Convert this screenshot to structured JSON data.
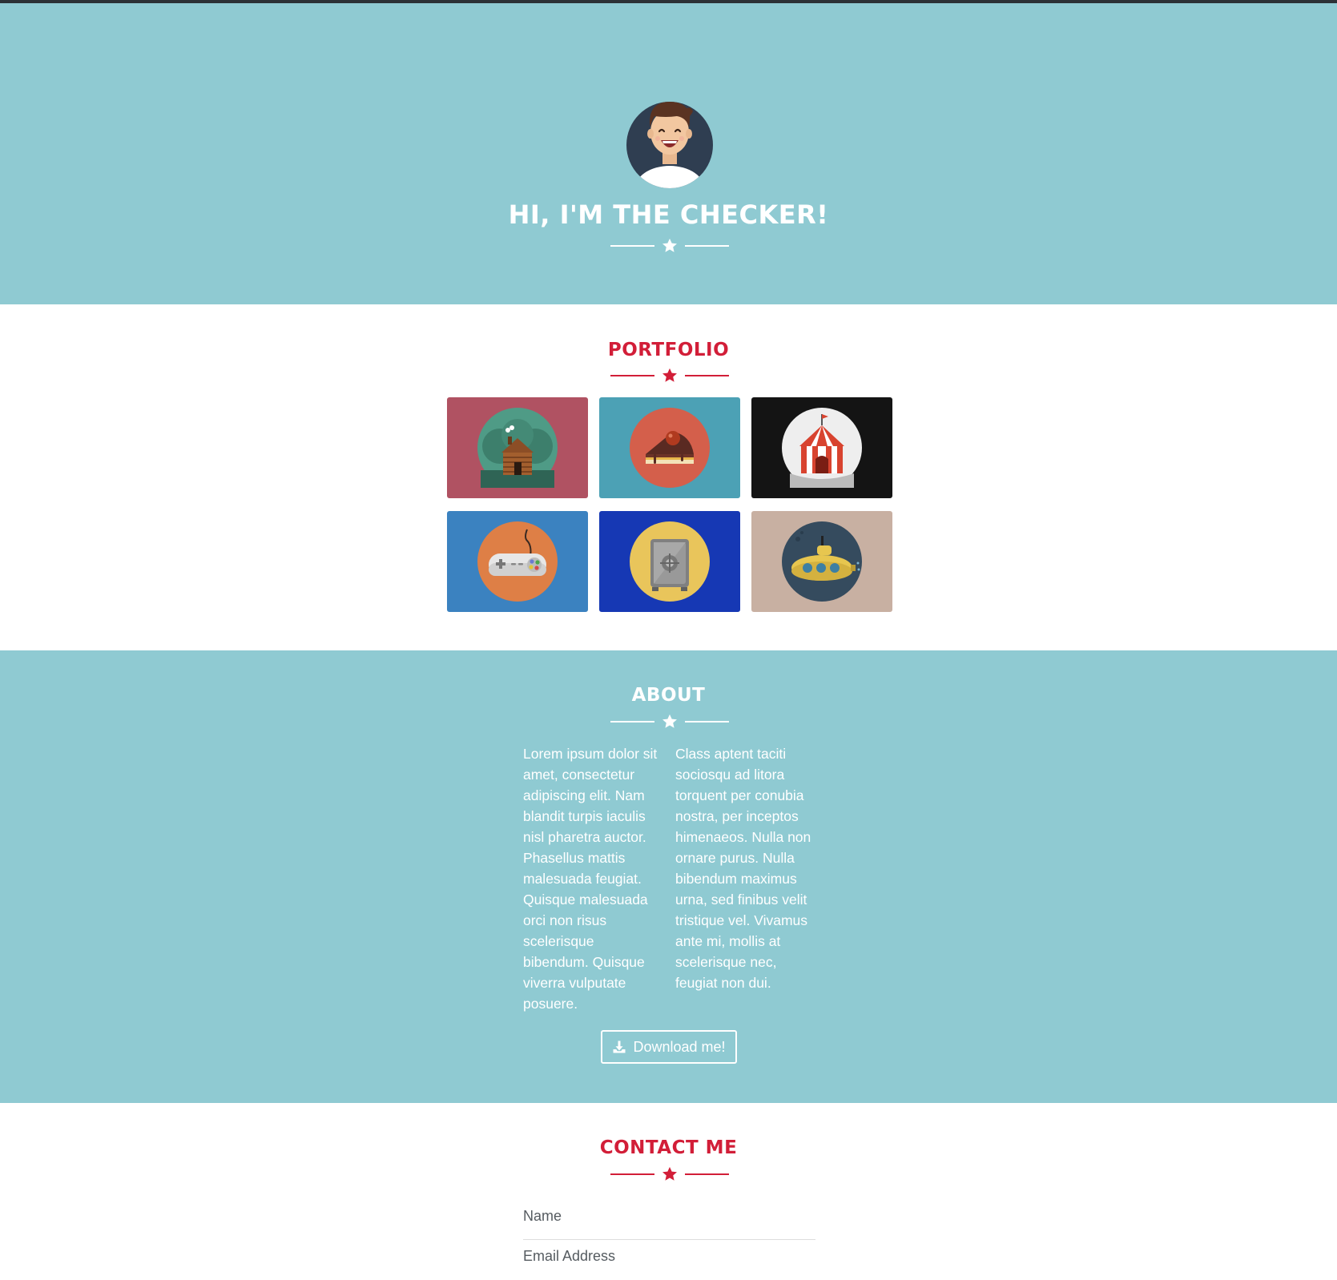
{
  "hero": {
    "title": "HI, I'M THE CHECKER!"
  },
  "portfolio": {
    "title": "PORTFOLIO",
    "items": [
      {
        "icon": "cabin-icon",
        "bg": "#b05262"
      },
      {
        "icon": "cake-icon",
        "bg": "#4ca1b5"
      },
      {
        "icon": "circus-tent-icon",
        "bg": "#141414"
      },
      {
        "icon": "game-controller-icon",
        "bg": "#3b82c0"
      },
      {
        "icon": "safe-icon",
        "bg": "#1638b4"
      },
      {
        "icon": "submarine-icon",
        "bg": "#c8b0a2"
      }
    ]
  },
  "about": {
    "title": "ABOUT",
    "col1": "Lorem ipsum dolor sit amet, consectetur adipiscing elit. Nam blandit turpis iaculis nisl pharetra auctor. Phasellus mattis malesuada feugiat. Quisque malesuada orci non risus scelerisque bibendum. Quisque viverra vulputate posuere.",
    "col2": "Class aptent taciti sociosqu ad litora torquent per conubia nostra, per inceptos himenaeos. Nulla non ornare purus. Nulla bibendum maximus urna, sed finibus velit tristique vel. Vivamus ante mi, mollis at scelerisque nec, feugiat non dui.",
    "download_label": "Download me!"
  },
  "contact": {
    "title": "CONTACT ME",
    "name_label": "Name",
    "email_label": "Email Address"
  },
  "colors": {
    "teal": "#8fcad2",
    "accent_red": "#d21e38",
    "white": "#ffffff"
  }
}
